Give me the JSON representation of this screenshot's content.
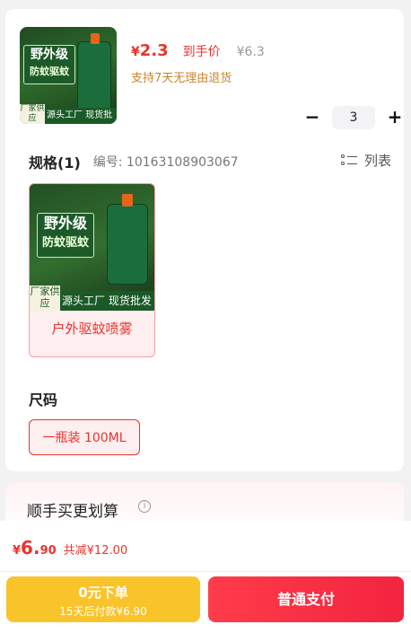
{
  "product": {
    "image_title": "野外级",
    "image_subtitle": "防蚊驱蚊",
    "image_factory": "厂家供应",
    "image_banner": "源头工厂  现货批发",
    "price_currency": "¥",
    "price_main": "2.3",
    "price_label": "到手价",
    "price_original": "¥6.3",
    "refund_note": "支持7天无理由退货",
    "quantity": "3",
    "minus_label": "−",
    "plus_label": "+"
  },
  "spec": {
    "title": "规格(1)",
    "number": "编号: 10163108903067",
    "list_label": "列表",
    "variant_label": "户外驱蚊喷雾",
    "variant_image_title": "野外级",
    "variant_image_subtitle": "防蚊驱蚊",
    "variant_image_factory": "厂家供应",
    "variant_image_banner": "源头工厂  现货批发"
  },
  "size": {
    "title": "尺码",
    "option": "一瓶装 100ML"
  },
  "addon": {
    "title": "顺手买更划算",
    "info_icon": "i"
  },
  "footer": {
    "total_currency": "¥",
    "total_main": "6.",
    "total_decimal": "90",
    "total_saving": "共减¥12.00",
    "credit_line1": "0元下单",
    "credit_line2": "15天后付款¥6.90",
    "pay_label": "普通支付"
  }
}
